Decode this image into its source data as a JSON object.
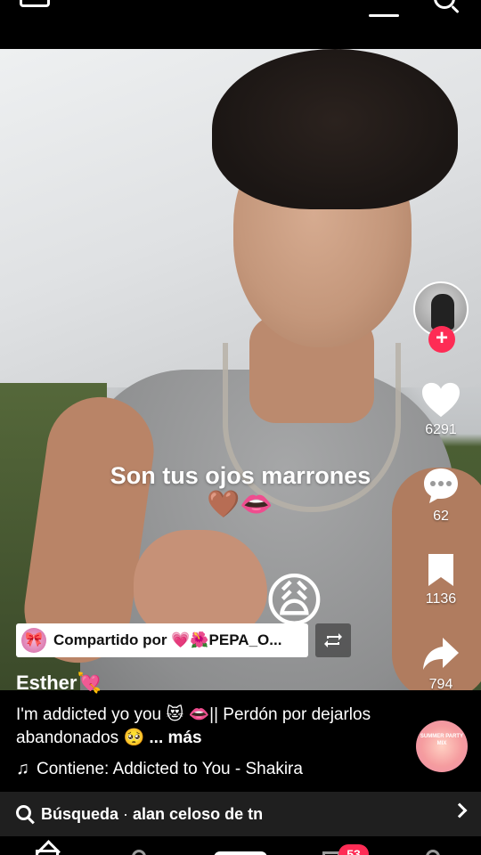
{
  "video": {
    "caption_text": "Son tus ojos marrones",
    "caption_emojis": "🤎👄",
    "sticker_emoji": "😩"
  },
  "actions": {
    "likes": "6291",
    "comments": "62",
    "saves": "1136",
    "shares": "794"
  },
  "shared_by": {
    "avatar_emoji": "🎀",
    "label": "Compartido por 💗🌺PEPA_O..."
  },
  "post": {
    "username": "Esther💘",
    "description": "I'm addicted yo you 😻 👄|| Perdón por dejarlos abandonados 🥺",
    "more_label": "... más",
    "music_prefix": "Contiene: Addicted to You - Shakira",
    "disc_text": "SUMMER PARTY MIX"
  },
  "search": {
    "label": "Búsqueda",
    "query": "alan celoso de tn"
  },
  "nav": {
    "inbox_badge": "53"
  },
  "icons": {
    "menu": "hamburger-icon",
    "search": "search-icon",
    "like": "heart-icon",
    "comment": "comment-icon",
    "save": "bookmark-icon",
    "share": "share-icon",
    "repost": "repost-icon",
    "music": "music-note-icon"
  },
  "colors": {
    "accent": "#fe2c55",
    "background": "#000000",
    "search_bg": "#1f1f1f"
  }
}
